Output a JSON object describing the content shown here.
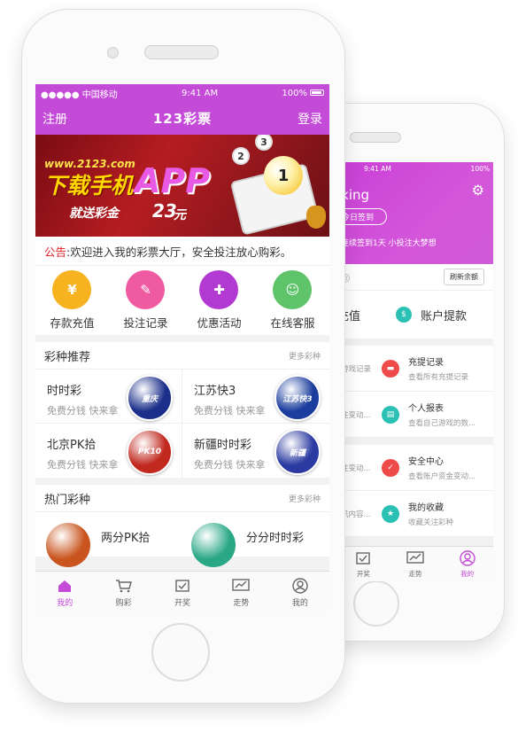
{
  "front_status": {
    "carrier": "●●●●● 中国移动",
    "time": "9:41 AM",
    "battery": "100%"
  },
  "front_nav": {
    "left": "注册",
    "title": "123彩票",
    "right": "登录"
  },
  "banner": {
    "url": "www.2123.com",
    "download": "下载手机",
    "app": "APP",
    "send": "就送彩金",
    "amount": "23",
    "unit": "元",
    "balls": [
      "1",
      "2",
      "3"
    ]
  },
  "notice": {
    "label": "公告",
    "text": ":欢迎进入我的彩票大厅，安全投注放心购彩。"
  },
  "quick": [
    {
      "label": "存款充值",
      "icon": "¥",
      "color": "#f6b21f"
    },
    {
      "label": "投注记录",
      "icon": "✎",
      "color": "#ef5aa0"
    },
    {
      "label": "优惠活动",
      "icon": "✚",
      "color": "#b23ad2"
    },
    {
      "label": "在线客服",
      "icon": "☺",
      "color": "#5fc36a"
    }
  ],
  "recommend": {
    "title": "彩种推荐",
    "more": "更多彩种",
    "items": [
      {
        "name": "时时彩",
        "sub": "免费分钱 快来拿",
        "logo": "重庆",
        "color": "#1b2f8a"
      },
      {
        "name": "江苏快3",
        "sub": "免费分钱 快来拿",
        "logo": "江苏快3",
        "color": "#1a3d9e"
      },
      {
        "name": "北京PK拾",
        "sub": "免费分钱 快来拿",
        "logo": "PK10",
        "color": "#c1281e"
      },
      {
        "name": "新疆时时彩",
        "sub": "免费分钱 快来拿",
        "logo": "新疆",
        "color": "#2a3aa1"
      }
    ]
  },
  "hot": {
    "title": "热门彩种",
    "more": "更多彩种",
    "items": [
      {
        "name": "两分PK拾",
        "color": "#c9541d"
      },
      {
        "name": "分分时时彩",
        "color": "#2aa886"
      }
    ]
  },
  "front_tabs": [
    {
      "label": "我的",
      "active": true
    },
    {
      "label": "购彩",
      "active": false
    },
    {
      "label": "开奖",
      "active": false
    },
    {
      "label": "走势",
      "active": false
    },
    {
      "label": "我的",
      "active": false
    }
  ],
  "back_status": {
    "time": "9:41 AM",
    "battery": "100%"
  },
  "back_header": {
    "name": "lking",
    "sign": "今日签到",
    "tag": "连续签到1天 小投注大梦想"
  },
  "back_money": {
    "refresh": "刷新余额",
    "deposit": "充值",
    "withdraw": "账户提款"
  },
  "back_list": [
    {
      "left": "游戏记录",
      "title": "充提记录",
      "sub": "查看所有充提记录",
      "color": "#ef4a4a",
      "icon": "▬"
    },
    {
      "left": "注变动...",
      "title": "个人报表",
      "sub": "查看自己游戏的数...",
      "color": "#2bc0b4",
      "icon": "▤"
    },
    {
      "left": "注变动...",
      "title": "安全中心",
      "sub": "查看账户资金变动...",
      "color": "#ef4a4a",
      "icon": "✓"
    },
    {
      "left": "讯内容...",
      "title": "我的收藏",
      "sub": "收藏关注彩种",
      "color": "#2bc0b4",
      "icon": "★"
    }
  ],
  "back_tabs": [
    {
      "label": "开奖",
      "active": false
    },
    {
      "label": "走势",
      "active": false
    },
    {
      "label": "我的",
      "active": true
    }
  ]
}
